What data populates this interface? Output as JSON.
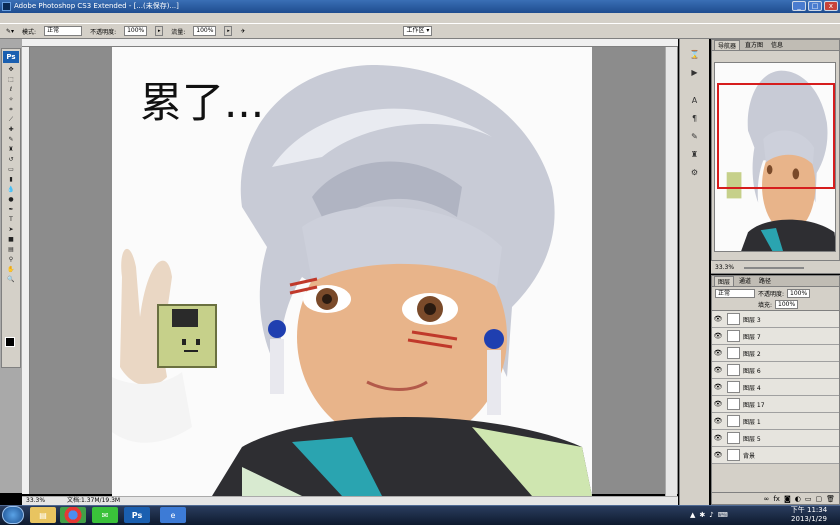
{
  "window": {
    "title": "Adobe Photoshop CS3 Extended - [...(未保存)...]",
    "controls": {
      "min": "_",
      "max": "□",
      "close": "x"
    }
  },
  "options_bar": {
    "mode_label": "模式:",
    "mode_value": "正常",
    "opacity_label": "不透明度:",
    "opacity_value": "100%",
    "flow_label": "流量:",
    "flow_value": "100%",
    "workspace_label": "工作区 ▾"
  },
  "toolbox": {
    "logo": "Ps",
    "tools": [
      "move",
      "marquee",
      "lasso",
      "quick-select",
      "crop",
      "slice",
      "heal",
      "brush",
      "stamp",
      "history",
      "eraser",
      "gradient",
      "blur",
      "dodge",
      "pen",
      "type",
      "path-select",
      "shape",
      "notes",
      "eyedropper",
      "hand",
      "zoom"
    ]
  },
  "document": {
    "zoom_status": "33.3%",
    "doc_info": "文档:1.37M/19.3M",
    "handwriting": "累了..."
  },
  "right_panel": {
    "nav_tabs": [
      "导航器",
      "直方图",
      "信息"
    ],
    "nav_zoom": "33.3%",
    "layers_tabs": [
      "图层",
      "通道",
      "路径"
    ],
    "blend_mode": "正常",
    "opacity_label": "不透明度:",
    "opacity_value": "100%",
    "fill_label": "填充:",
    "fill_value": "100%",
    "layers": [
      {
        "name": "图层 3",
        "visible": true,
        "selected": false
      },
      {
        "name": "图层 7",
        "visible": true,
        "selected": false
      },
      {
        "name": "图层 2",
        "visible": true,
        "selected": false
      },
      {
        "name": "图层 6",
        "visible": true,
        "selected": false
      },
      {
        "name": "图层 4",
        "visible": true,
        "selected": false
      },
      {
        "name": "图层 17",
        "visible": true,
        "selected": false
      },
      {
        "name": "图层 1",
        "visible": true,
        "selected": false
      },
      {
        "name": "图层 5",
        "visible": true,
        "selected": false
      },
      {
        "name": "背景",
        "visible": true,
        "selected": false
      }
    ]
  },
  "taskbar": {
    "apps": [
      "explorer",
      "chrome",
      "line",
      "photoshop",
      "ie"
    ],
    "time": "下午 11:34",
    "date": "2013/1/29"
  },
  "colors": {
    "workspace": "#a9a9a9",
    "panel": "#d4d0c8",
    "nav_frame": "#d61d1d",
    "taskbar": "#1b2b45"
  }
}
